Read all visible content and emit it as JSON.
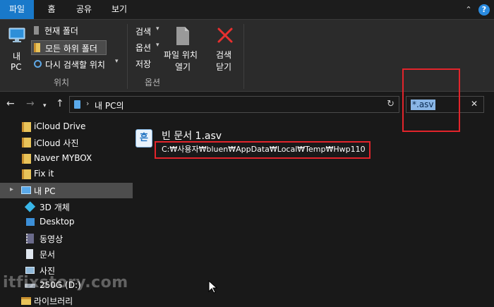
{
  "tabs": {
    "file": "파일",
    "home": "홈",
    "share": "공유",
    "view": "보기"
  },
  "ribbon": {
    "my_pc_label_1": "내",
    "my_pc_label_2": "PC",
    "current_folder": "현재 폴더",
    "all_subfolders": "모든 하위 폴더",
    "search_again": "다시 검색할 위치",
    "group_location": "위치",
    "search_opt": "검색",
    "options": "옵션",
    "save": "저장",
    "open_file_loc_1": "파일 위치",
    "open_file_loc_2": "열기",
    "close_search_1": "검색",
    "close_search_2": "닫기",
    "group_options": "옵션"
  },
  "address": {
    "path": "내 PC의"
  },
  "search": {
    "query": "*.asv"
  },
  "nav": [
    {
      "label": "iCloud Drive",
      "icon": "icloud-folder-icon"
    },
    {
      "label": "iCloud 사진",
      "icon": "icloud-folder-icon"
    },
    {
      "label": "Naver MYBOX",
      "icon": "folder-icon"
    },
    {
      "label": "Fix it",
      "icon": "folder-icon"
    },
    {
      "label": "내 PC",
      "icon": "computer-icon"
    },
    {
      "label": "3D 개체",
      "icon": "3d-objects-icon"
    },
    {
      "label": "Desktop",
      "icon": "desktop-icon"
    },
    {
      "label": "동영상",
      "icon": "video-icon"
    },
    {
      "label": "문서",
      "icon": "document-icon"
    },
    {
      "label": "사진",
      "icon": "pictures-icon"
    },
    {
      "label": "250G (D:)",
      "icon": "drive-icon"
    },
    {
      "label": "라이브러리",
      "icon": "library-icon"
    }
  ],
  "result": {
    "name": "빈 문서 1.asv",
    "path": "C:₩사용자₩bluen₩AppData₩Local₩Temp₩Hwp110",
    "app_icon_glyph": "흔"
  },
  "watermark": "itfixstory.com",
  "colors": {
    "accent": "#1979ca",
    "highlight_box": "#e2242b",
    "selected_text_bg": "#8ab6e6"
  }
}
